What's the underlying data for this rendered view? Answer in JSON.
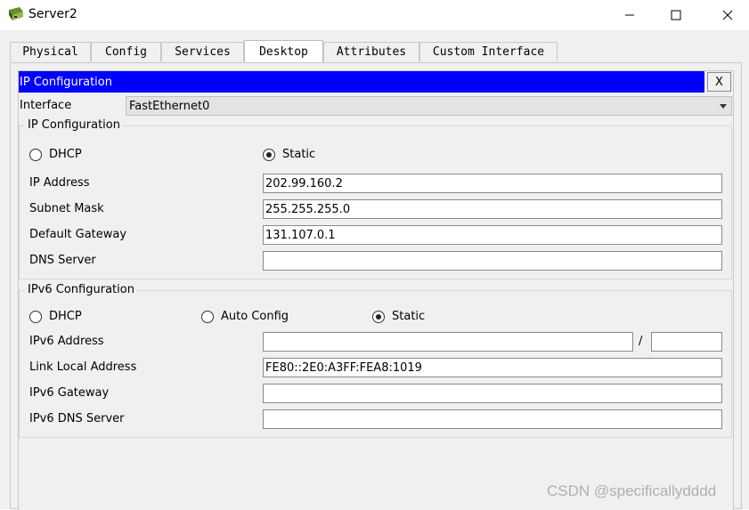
{
  "window": {
    "title": "Server2",
    "minimize_icon": "minimize-icon",
    "maximize_icon": "maximize-icon",
    "close_icon": "close-icon"
  },
  "tabs": [
    {
      "label": "Physical"
    },
    {
      "label": "Config"
    },
    {
      "label": "Services"
    },
    {
      "label": "Desktop",
      "active": true
    },
    {
      "label": "Attributes"
    },
    {
      "label": "Custom Interface"
    }
  ],
  "panel": {
    "title": "IP Configuration",
    "close_label": "X",
    "interface_label": "Interface",
    "interface_value": "FastEthernet0"
  },
  "ipv4": {
    "group_title": "IP Configuration",
    "dhcp_label": "DHCP",
    "static_label": "Static",
    "selected_mode": "Static",
    "ip_label": "IP Address",
    "ip_value": "202.99.160.2",
    "mask_label": "Subnet Mask",
    "mask_value": "255.255.255.0",
    "gateway_label": "Default Gateway",
    "gateway_value": "131.107.0.1",
    "dns_label": "DNS Server",
    "dns_value": ""
  },
  "ipv6": {
    "group_title": "IPv6 Configuration",
    "dhcp_label": "DHCP",
    "auto_label": "Auto Config",
    "static_label": "Static",
    "selected_mode": "Static",
    "address_label": "IPv6 Address",
    "address_value": "",
    "prefix_sep": "/",
    "prefix_value": "",
    "link_local_label": "Link Local Address",
    "link_local_value": "FE80::2E0:A3FF:FEA8:1019",
    "gateway_label": "IPv6 Gateway",
    "gateway_value": "",
    "dns_label": "IPv6 DNS Server",
    "dns_value": ""
  },
  "watermark": "CSDN @specificallydddd",
  "colors": {
    "title_bar_blue": "#0000ff"
  }
}
